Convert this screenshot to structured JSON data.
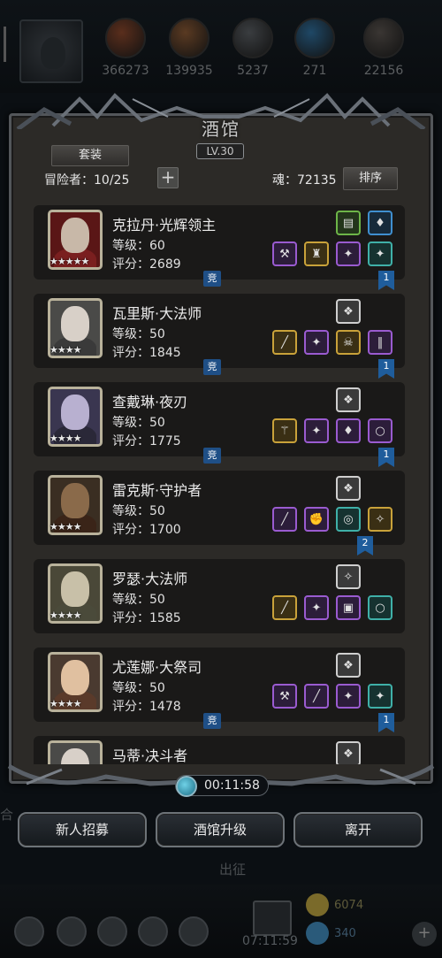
{
  "resources": [
    {
      "icon": "wood-orb-icon",
      "value": "366273",
      "color": "#5a2e1c"
    },
    {
      "icon": "leather-orb-icon",
      "value": "139935",
      "color": "#5a3a22"
    },
    {
      "icon": "iron-orb-icon",
      "value": "5237",
      "color": "#3a3d40"
    },
    {
      "icon": "crystal-orb-icon",
      "value": "271",
      "color": "#1f4866"
    },
    {
      "icon": "ore-orb-icon",
      "value": "22156",
      "color": "#3a3633"
    }
  ],
  "tavern": {
    "title": "酒馆",
    "level": "LV.30",
    "outfit_tab": "套装",
    "adventurers": "冒险者：10/25",
    "add": "+",
    "soul": "魂：72135",
    "sort": "排序"
  },
  "heroes": [
    {
      "name": "克拉丹·光辉领主",
      "level": "等级：60",
      "score": "评分：2689",
      "stars": "★★★★★",
      "face": "#c8b8a8",
      "body": "#7a1f1f",
      "bg": "#5a1616",
      "slots_top": [
        {
          "q": "green",
          "icon": "scroll-icon",
          "g": "▤"
        },
        {
          "q": "blue",
          "icon": "potion-icon",
          "g": "♦"
        }
      ],
      "slots_bottom": [
        {
          "q": "purple",
          "icon": "mace-icon",
          "g": "⚒"
        },
        {
          "q": "gold",
          "icon": "helmet-icon",
          "g": "♜"
        },
        {
          "q": "purple",
          "icon": "shuriken-icon",
          "g": "✦"
        },
        {
          "q": "teal",
          "icon": "shuriken-icon",
          "g": "✦"
        }
      ],
      "comp": "竞",
      "ribbon": "1"
    },
    {
      "name": "瓦里斯·大法师",
      "level": "等级：50",
      "score": "评分：1845",
      "stars": "★★★★",
      "face": "#d8d0c8",
      "body": "#3a3a3a",
      "bg": "#4a4a48",
      "slots_top": [
        {
          "q": "white",
          "icon": "bracer-icon",
          "g": "❖"
        }
      ],
      "slots_bottom": [
        {
          "q": "gold",
          "icon": "staff-icon",
          "g": "╱"
        },
        {
          "q": "purple",
          "icon": "shuriken-icon",
          "g": "✦"
        },
        {
          "q": "gold",
          "icon": "skull-mask-icon",
          "g": "☠"
        },
        {
          "q": "purple",
          "icon": "greaves-icon",
          "g": "‖"
        }
      ],
      "comp": "竞",
      "ribbon": "1"
    },
    {
      "name": "查戴琳·夜刃",
      "level": "等级：50",
      "score": "评分：1775",
      "stars": "★★★★",
      "face": "#b8b0d0",
      "body": "#2a2838",
      "bg": "#3a3650",
      "slots_top": [
        {
          "q": "white",
          "icon": "bracer-icon",
          "g": "❖"
        }
      ],
      "slots_bottom": [
        {
          "q": "gold",
          "icon": "wand-icon",
          "g": "⚚"
        },
        {
          "q": "purple",
          "icon": "shuriken-icon",
          "g": "✦"
        },
        {
          "q": "purple",
          "icon": "armor-icon",
          "g": "♦"
        },
        {
          "q": "purple",
          "icon": "ring-icon",
          "g": "○"
        }
      ],
      "comp": "竞",
      "ribbon": "1"
    },
    {
      "name": "雷克斯·守护者",
      "level": "等级：50",
      "score": "评分：1700",
      "stars": "★★★★",
      "face": "#8a6a4a",
      "body": "#3a2418",
      "bg": "#3a2e22",
      "slots_top": [
        {
          "q": "white",
          "icon": "bracer-icon",
          "g": "❖"
        }
      ],
      "slots_bottom": [
        {
          "q": "purple",
          "icon": "sword-icon",
          "g": "╱"
        },
        {
          "q": "purple",
          "icon": "gauntlet-icon",
          "g": "✊"
        },
        {
          "q": "teal",
          "icon": "amulet-icon",
          "g": "◎"
        },
        {
          "q": "gold",
          "icon": "dagger-icon",
          "g": "✧"
        }
      ],
      "comp": "",
      "ribbon": "2"
    },
    {
      "name": "罗瑟·大法师",
      "level": "等级：50",
      "score": "评分：1585",
      "stars": "★★★★",
      "face": "#c8c0a8",
      "body": "#4a4a3a",
      "bg": "#4a4838",
      "slots_top": [
        {
          "q": "white",
          "icon": "dagger-icon",
          "g": "✧"
        }
      ],
      "slots_bottom": [
        {
          "q": "gold",
          "icon": "staff-icon",
          "g": "╱"
        },
        {
          "q": "purple",
          "icon": "shuriken-icon",
          "g": "✦"
        },
        {
          "q": "purple",
          "icon": "book-icon",
          "g": "▣"
        },
        {
          "q": "teal",
          "icon": "ring-icon",
          "g": "○"
        }
      ],
      "comp": "",
      "ribbon": ""
    },
    {
      "name": "尤莲娜·大祭司",
      "level": "等级：50",
      "score": "评分：1478",
      "stars": "★★★★",
      "face": "#e0c0a0",
      "body": "#5a3a2a",
      "bg": "#4a3a30",
      "slots_top": [
        {
          "q": "white",
          "icon": "bracer-icon",
          "g": "❖"
        }
      ],
      "slots_bottom": [
        {
          "q": "purple",
          "icon": "hammer-icon",
          "g": "⚒"
        },
        {
          "q": "purple",
          "icon": "sword-icon",
          "g": "╱"
        },
        {
          "q": "purple",
          "icon": "shuriken-icon",
          "g": "✦"
        },
        {
          "q": "teal",
          "icon": "shuriken-icon",
          "g": "✦"
        }
      ],
      "comp": "竞",
      "ribbon": "1"
    },
    {
      "name": "马蒂·决斗者",
      "level": "",
      "score": "",
      "stars": "",
      "face": "#d8d0c8",
      "body": "#3a3a3a",
      "bg": "#4a4a48",
      "slots_top": [
        {
          "q": "white",
          "icon": "bracer-icon",
          "g": "❖"
        }
      ],
      "slots_bottom": [],
      "comp": "",
      "ribbon": ""
    }
  ],
  "timer": "00:11:58",
  "buttons": {
    "recruit": "新人招募",
    "upgrade": "酒馆升级",
    "leave": "离开"
  },
  "background": {
    "expedition": "出征",
    "chest_timer": "07:11:59",
    "gold": "6074",
    "gems": "340"
  }
}
